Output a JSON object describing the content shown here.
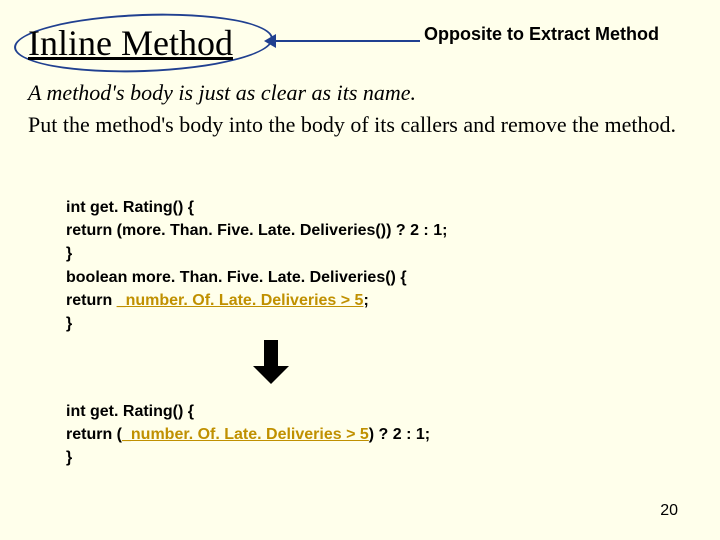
{
  "title": "Inline Method",
  "note": "Opposite to Extract Method",
  "desc_italic": "A method's body is just as clear as its name.",
  "desc_plain": "Put the method's body into the body of its callers and remove the method.",
  "code_before": {
    "l1": "int get. Rating() {",
    "l2a": "return (more. Than. Five. Late. Deliveries()) ? 2 : 1;",
    "l3": "}",
    "l4": "boolean more. Than. Five. Late. Deliveries() {",
    "l5a": "return ",
    "l5b": "_number. Of. Late. Deliveries > 5",
    "l5c": ";",
    "l6": "}"
  },
  "code_after": {
    "l1": "int get. Rating() {",
    "l2a": "return (",
    "l2b": "_number. Of. Late. Deliveries > 5",
    "l2c": ") ? 2 : 1;",
    "l3": "}"
  },
  "page_number": "20"
}
